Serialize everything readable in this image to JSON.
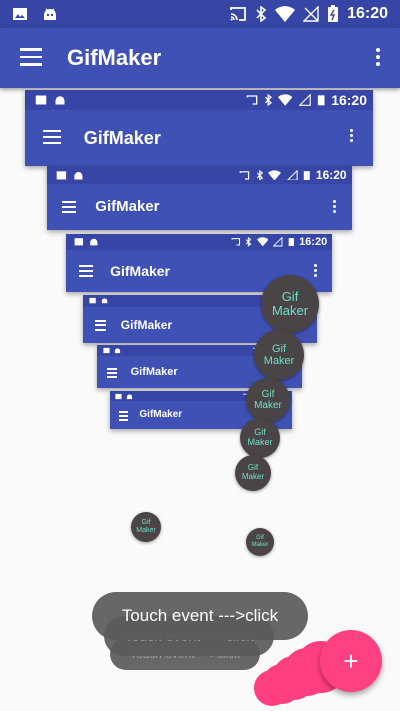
{
  "status_bar": {
    "time": "16:20"
  },
  "app_bar": {
    "title": "GifMaker"
  },
  "colors": {
    "primary": "#3f51b5",
    "primary_dark": "#3746a6",
    "accent": "#ff4081",
    "bubble": "#4a4446",
    "bubble_text": "#6ee0c8"
  },
  "bubbles": {
    "label_line1": "Gif",
    "label_line2": "Maker"
  },
  "toast": {
    "text": "Touch event --->click"
  },
  "fab": {
    "icon": "plus-icon",
    "symbol": "+"
  },
  "icons": [
    "image-icon",
    "android-icon",
    "cast-icon",
    "bluetooth-icon",
    "wifi-icon",
    "no-signal-icon",
    "battery-icon",
    "menu-icon",
    "more-vert-icon"
  ]
}
